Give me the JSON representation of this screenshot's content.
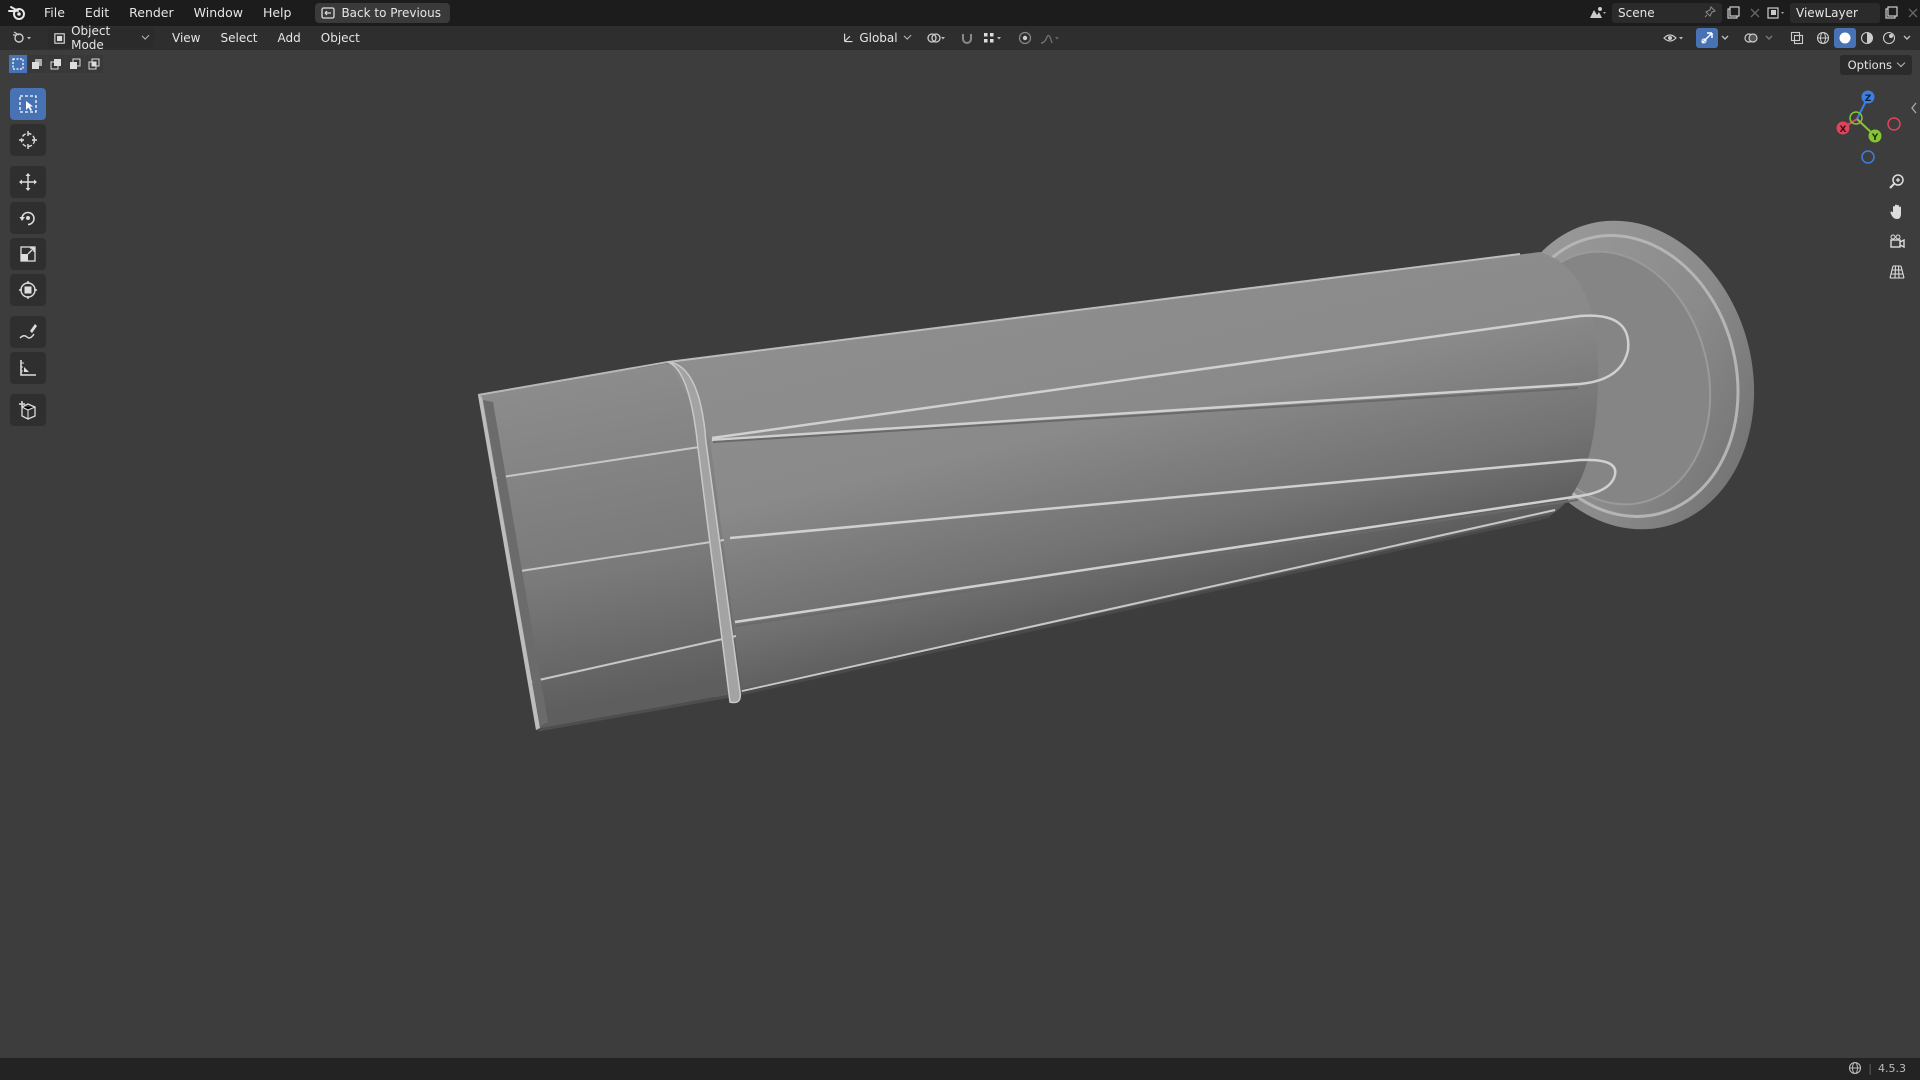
{
  "menu": {
    "items": [
      "File",
      "Edit",
      "Render",
      "Window",
      "Help"
    ],
    "back_label": "Back to Previous"
  },
  "scene": {
    "name": "Scene"
  },
  "view_layer": {
    "name": "ViewLayer"
  },
  "header": {
    "mode": "Object Mode",
    "menus": [
      "View",
      "Select",
      "Add",
      "Object"
    ],
    "orientation": "Global"
  },
  "viewport": {
    "options_label": "Options"
  },
  "gizmo": {
    "x": "X",
    "y": "Y",
    "z": "Z"
  },
  "status": {
    "version": "4.5.3"
  },
  "colors": {
    "accent": "#4772b3",
    "axis_x": "#e0435c",
    "axis_y": "#86c534",
    "axis_z": "#3b7fe0",
    "viewport_bg": "#3d3d3d"
  }
}
